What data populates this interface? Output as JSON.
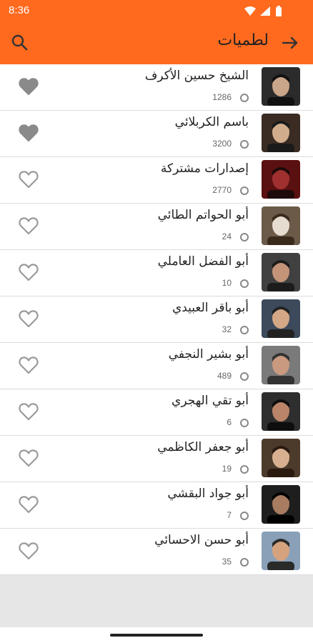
{
  "status": {
    "time": "8:36"
  },
  "header": {
    "title": "لطميات"
  },
  "icons": {
    "search": "search-icon",
    "back": "arrow-forward-icon",
    "favorite": "heart-icon",
    "count": "circle-icon"
  },
  "colors": {
    "accent": "#ff6a1f",
    "heart_filled": "#8a8a8a",
    "heart_outline": "#9a9a9a"
  },
  "artists": [
    {
      "name": "الشيخ حسين الأكرف",
      "count": "1286",
      "favorite": true
    },
    {
      "name": "باسم الكربلائي",
      "count": "3200",
      "favorite": true
    },
    {
      "name": "إصدارات مشتركة",
      "count": "2770",
      "favorite": false
    },
    {
      "name": "أبو الحواتم الطائي",
      "count": "24",
      "favorite": false
    },
    {
      "name": "أبو الفضل العاملي",
      "count": "10",
      "favorite": false
    },
    {
      "name": "أبو باقر العبيدي",
      "count": "32",
      "favorite": false
    },
    {
      "name": "أبو بشير النجفي",
      "count": "489",
      "favorite": false
    },
    {
      "name": "أبو تقي الهجري",
      "count": "6",
      "favorite": false
    },
    {
      "name": "أبو جعفر الكاظمي",
      "count": "19",
      "favorite": false
    },
    {
      "name": "أبو جواد البقشي",
      "count": "7",
      "favorite": false
    },
    {
      "name": "أبو حسن الاحسائي",
      "count": "35",
      "favorite": false
    }
  ]
}
